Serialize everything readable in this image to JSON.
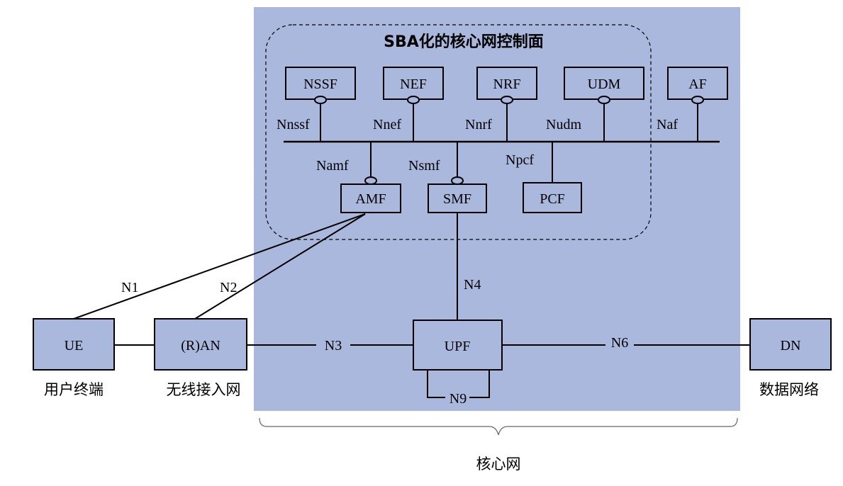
{
  "title": "SBA化的核心网控制面",
  "colors": {
    "core_bg": "#a9b8dc",
    "box_fill": "#a9b8dc",
    "stroke": "#000000"
  },
  "control_plane_nfs": {
    "nssf": "NSSF",
    "nef": "NEF",
    "nrf": "NRF",
    "udm": "UDM",
    "af": "AF",
    "amf": "AMF",
    "smf": "SMF",
    "pcf": "PCF"
  },
  "service_interfaces": {
    "nnssf": "Nnssf",
    "nnef": "Nnef",
    "nnrf": "Nnrf",
    "nudm": "Nudm",
    "naf": "Naf",
    "namf": "Namf",
    "nsmf": "Nsmf",
    "npcf": "Npcf"
  },
  "user_plane": {
    "ue": "UE",
    "ran": "(R)AN",
    "upf": "UPF",
    "dn": "DN"
  },
  "reference_points": {
    "n1": "N1",
    "n2": "N2",
    "n3": "N3",
    "n4": "N4",
    "n6": "N6",
    "n9": "N9"
  },
  "captions": {
    "ue": "用户终端",
    "ran": "无线接入网",
    "dn": "数据网络",
    "core": "核心网"
  }
}
